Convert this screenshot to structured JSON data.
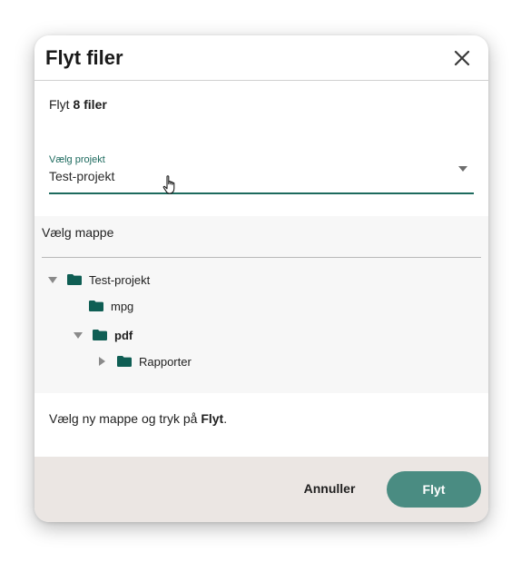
{
  "dialog": {
    "title": "Flyt filer",
    "close_icon": "close-icon",
    "subtitle_prefix": "Flyt ",
    "subtitle_bold": "8 filer"
  },
  "project_select": {
    "label": "Vælg projekt",
    "value": "Test-projekt",
    "arrow_icon": "chevron-down-icon"
  },
  "folder_picker": {
    "header": "Vælg mappe",
    "tree": [
      {
        "label": "Test-projekt",
        "state": "expanded",
        "bold": false
      },
      {
        "label": "mpg",
        "state": "leaf",
        "bold": false
      },
      {
        "label": "pdf",
        "state": "expanded",
        "bold": true
      },
      {
        "label": "Rapporter",
        "state": "collapsed",
        "bold": false
      }
    ]
  },
  "hint": {
    "prefix": "Vælg ny mappe og tryk på ",
    "bold": "Flyt",
    "suffix": "."
  },
  "footer": {
    "cancel_label": "Annuller",
    "confirm_label": "Flyt"
  },
  "colors": {
    "accent": "#1d6a5e",
    "folder": "#0f5e54",
    "primary_button": "#4a8c82",
    "footer_bg": "#ebe6e3"
  }
}
